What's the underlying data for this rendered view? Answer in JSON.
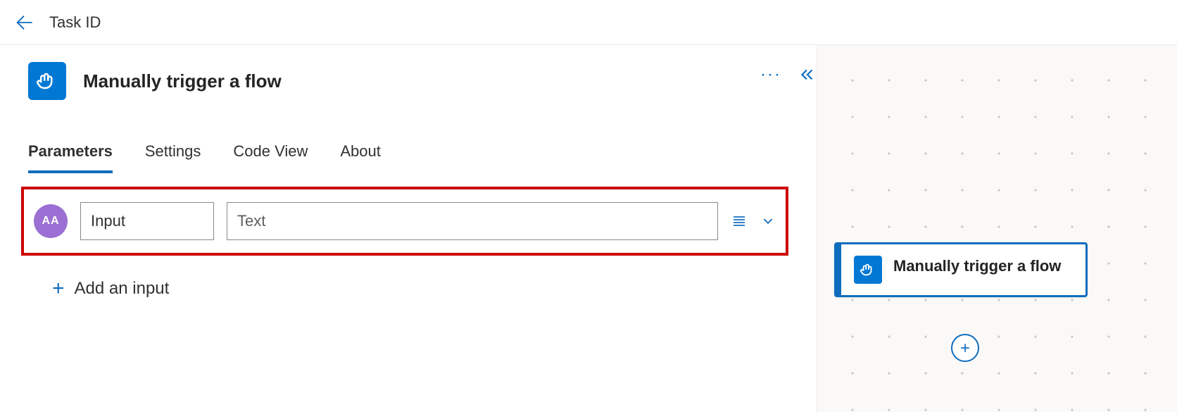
{
  "header": {
    "title": "Task ID"
  },
  "trigger": {
    "title": "Manually trigger a flow"
  },
  "tabs": [
    {
      "label": "Parameters",
      "active": true
    },
    {
      "label": "Settings",
      "active": false
    },
    {
      "label": "Code View",
      "active": false
    },
    {
      "label": "About",
      "active": false
    }
  ],
  "inputRow": {
    "typeBadge": "AA",
    "nameValue": "Input",
    "textValue": "Text"
  },
  "addInput": {
    "label": "Add an input"
  },
  "canvas": {
    "nodeTitle": "Manually trigger a flow"
  }
}
